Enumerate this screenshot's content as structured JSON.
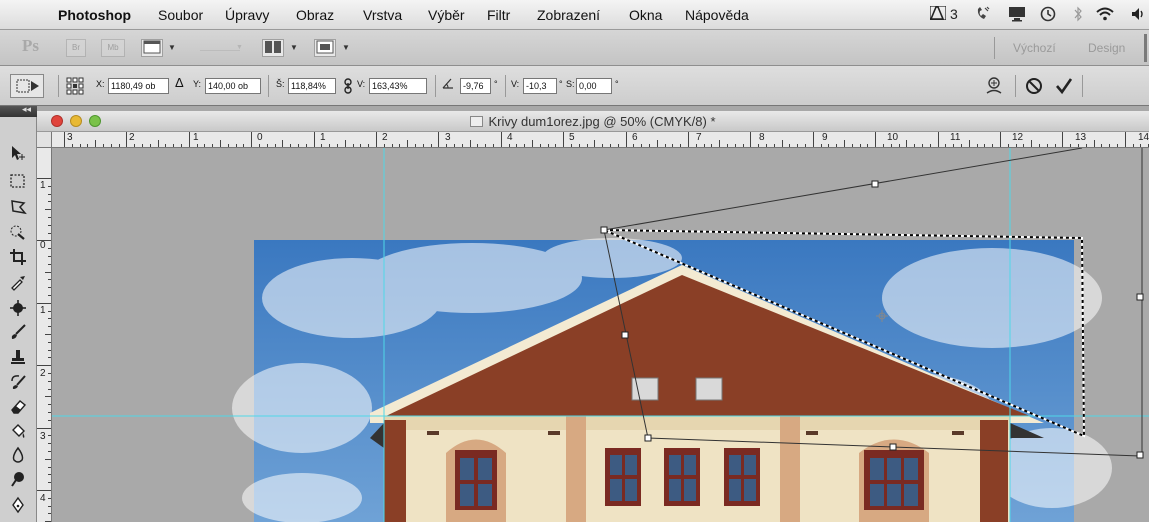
{
  "menubar": {
    "app_name": "Photoshop",
    "items": [
      "Soubor",
      "Úpravy",
      "Obraz",
      "Vrstva",
      "Výběr",
      "Filtr",
      "Zobrazení",
      "Okna",
      "Nápověda"
    ],
    "status_number": "3"
  },
  "appbar": {
    "logo": "Ps",
    "br_label": "Br",
    "mb_label": "Mb",
    "workspaces": [
      "Výchozí",
      "Design"
    ]
  },
  "options": {
    "x_label": "X:",
    "x_value": "1180,49 ob",
    "y_label": "Y:",
    "y_value": "140,00 ob",
    "w_label": "Š:",
    "w_value": "118,84%",
    "h_label": "V:",
    "h_value": "163,43%",
    "angle_value": "-9,76",
    "angle_unit": "°",
    "hskew_label": "V:",
    "hskew_value": "-10,3",
    "vskew_label": "S:",
    "vskew_value": "0,00",
    "degree": "°"
  },
  "document": {
    "title": "Krivy dum1orez.jpg @ 50% (CMYK/8) *"
  },
  "rulers": {
    "horizontal": [
      "3",
      "2",
      "1",
      "0",
      "1",
      "2",
      "3",
      "4",
      "5",
      "6",
      "7",
      "8",
      "9",
      "10",
      "11",
      "12",
      "13",
      "14"
    ],
    "vertical": [
      "1",
      "0",
      "1",
      "2",
      "3",
      "4"
    ]
  },
  "colors": {
    "guide": "#4fd8e8",
    "sky": "#3f7fc4",
    "roof_brown": "#8a3f26",
    "wall_cream": "#efe3c4",
    "accent_red": "#e0443c"
  }
}
